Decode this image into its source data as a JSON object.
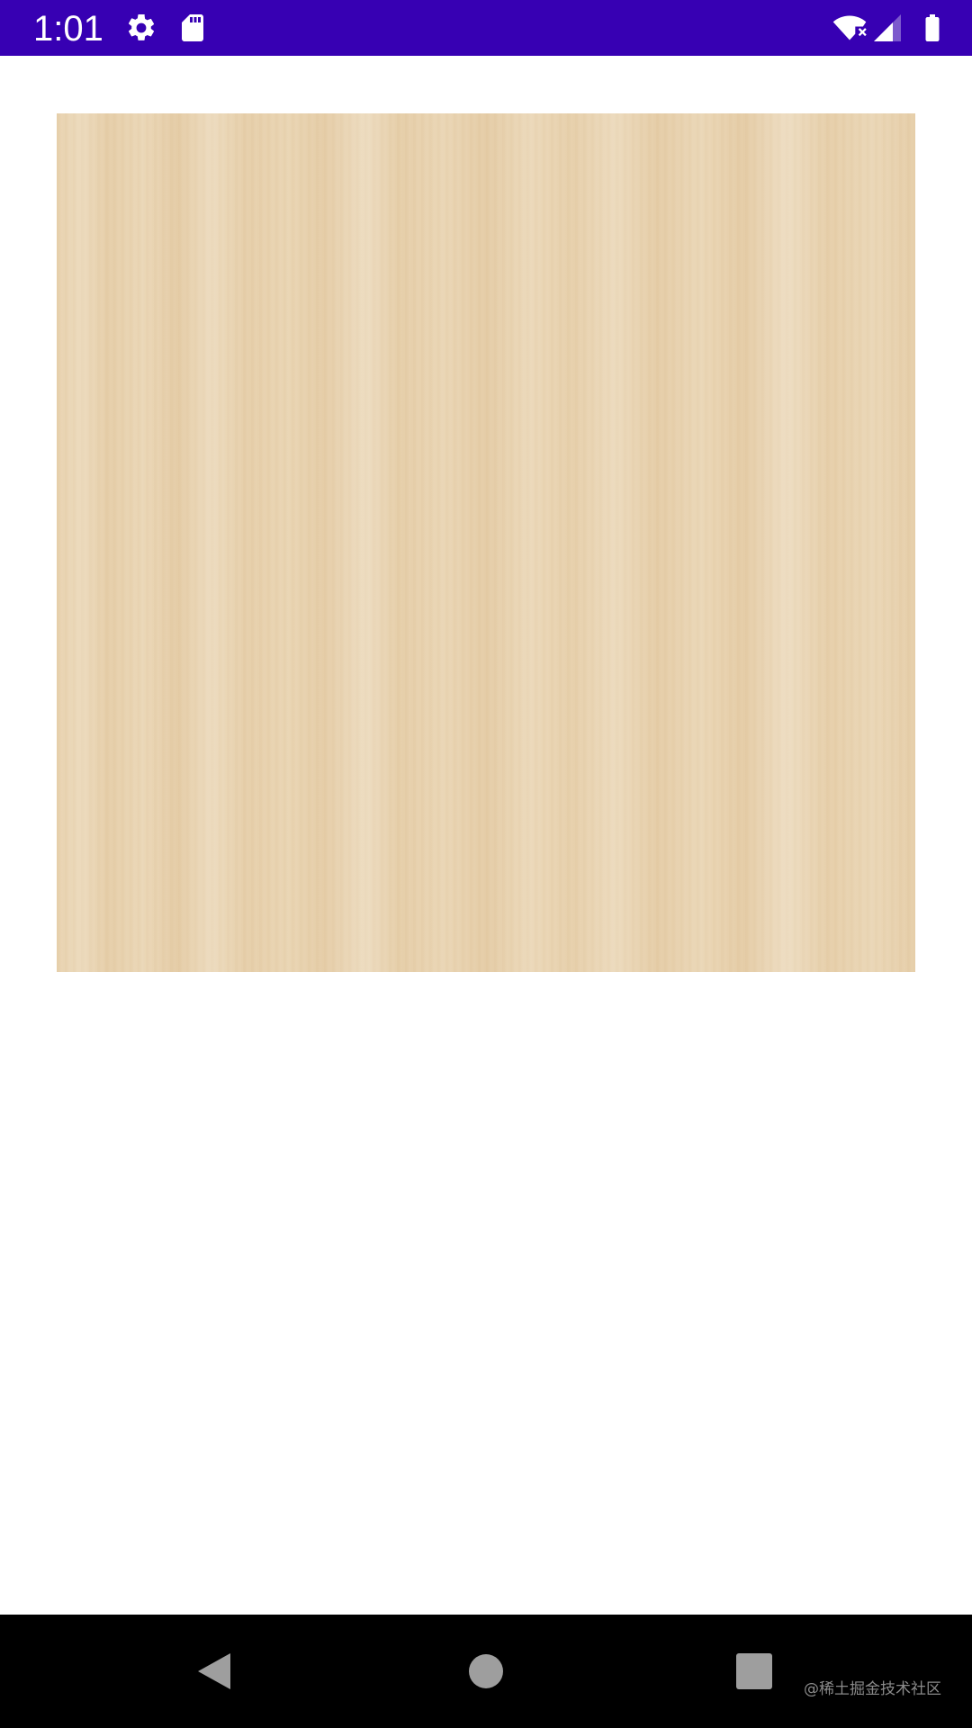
{
  "status_bar": {
    "time": "1:01",
    "background_color": "#3700b3",
    "left_icons": [
      "settings-gear-icon",
      "sd-card-icon"
    ],
    "right_icons": [
      "wifi-no-internet-icon",
      "cellular-signal-icon",
      "battery-icon"
    ]
  },
  "content": {
    "image": "wood-texture-image",
    "image_color": "#e8d2ae"
  },
  "navigation_bar": {
    "background_color": "#000000",
    "buttons": [
      "back-button",
      "home-button",
      "recents-button"
    ],
    "watermark": "@稀土掘金技术社区"
  }
}
